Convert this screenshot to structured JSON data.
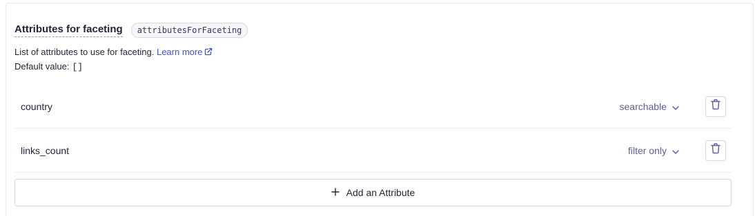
{
  "section": {
    "title": "Attributes for faceting",
    "code_name": "attributesForFaceting",
    "description": "List of attributes to use for faceting.",
    "learn_more": "Learn more",
    "default_label": "Default value:",
    "default_value": "[]"
  },
  "attributes": [
    {
      "name": "country",
      "mode": "searchable"
    },
    {
      "name": "links_count",
      "mode": "filter only"
    }
  ],
  "actions": {
    "add_label": "Add an Attribute"
  },
  "colors": {
    "link": "#3c4fe0",
    "select_text": "#5a5e9a",
    "border": "#d6d6e7"
  },
  "icons": [
    "external-link-icon",
    "chevron-down-icon",
    "trash-icon",
    "plus-icon"
  ]
}
